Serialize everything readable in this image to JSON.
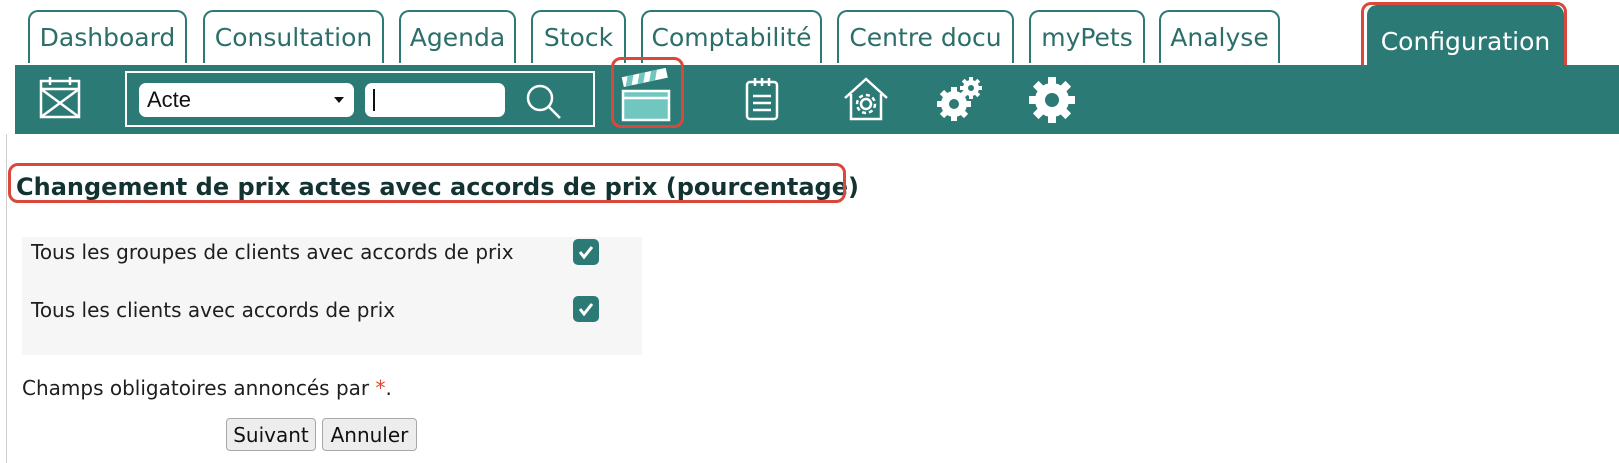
{
  "tabs": [
    {
      "label": "Dashboard"
    },
    {
      "label": "Consultation"
    },
    {
      "label": "Agenda"
    },
    {
      "label": "Stock"
    },
    {
      "label": "Comptabilité"
    },
    {
      "label": "Centre docu"
    },
    {
      "label": "myPets"
    },
    {
      "label": "Analyse"
    },
    {
      "label": "Configuration",
      "active": true
    }
  ],
  "toolbar": {
    "search": {
      "type_select_value": "Acte",
      "query_value": ""
    },
    "icons": [
      "calendar-icon",
      "search-icon",
      "clapperboard-icon",
      "clipboard-icon",
      "house-gear-icon",
      "gears-icon",
      "gear-icon"
    ]
  },
  "page": {
    "title": "Changement de prix actes avec accords de prix (pourcentage)",
    "options": [
      {
        "label": "Tous les groupes de clients avec accords de prix",
        "checked": true
      },
      {
        "label": "Tous les clients avec accords de prix",
        "checked": true
      }
    ],
    "required_note_prefix": "Champs obligatoires annoncés par ",
    "required_star": "*",
    "required_note_suffix": ".",
    "buttons": {
      "next": "Suivant",
      "cancel": "Annuler"
    }
  },
  "colors": {
    "primary": "#2c7a75",
    "highlight": "#d9483b",
    "required": "#e0452a",
    "panel_bg": "#f6f6f6"
  }
}
